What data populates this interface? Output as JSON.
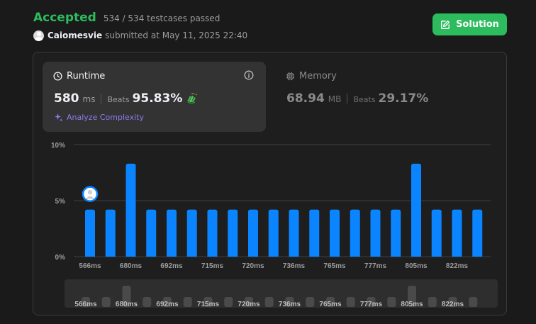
{
  "header": {
    "status": "Accepted",
    "testcases": "534 / 534 testcases passed",
    "username": "Caiomesvie",
    "submitted_at": "submitted at May 11, 2025 22:40"
  },
  "solution_button": {
    "label": "Solution",
    "icon": "edit-icon"
  },
  "runtime": {
    "title": "Runtime",
    "value": "580",
    "unit": "ms",
    "beats_label": "Beats",
    "beats_value": "95.83%",
    "analyze_label": "Analyze Complexity"
  },
  "memory": {
    "title": "Memory",
    "value": "68.94",
    "unit": "MB",
    "beats_label": "Beats",
    "beats_value": "29.17%"
  },
  "colors": {
    "accepted": "#2cbb5d",
    "bar": "#0a84ff",
    "analyze": "#8e7cf0",
    "minimap_bar": "#4a4a4a"
  },
  "chart_data": {
    "type": "bar",
    "categories": [
      "566ms",
      "",
      "680ms",
      "",
      "692ms",
      "",
      "715ms",
      "",
      "720ms",
      "",
      "736ms",
      "",
      "765ms",
      "",
      "777ms",
      "",
      "805ms",
      "",
      "822ms",
      ""
    ],
    "values": [
      4.2,
      4.2,
      8.3,
      4.2,
      4.2,
      4.2,
      4.2,
      4.2,
      4.2,
      4.2,
      4.2,
      4.2,
      4.2,
      4.2,
      4.2,
      4.2,
      8.3,
      4.2,
      4.2,
      4.2
    ],
    "ylim": [
      0,
      10
    ],
    "yticks": [
      "0%",
      "5%",
      "10%"
    ],
    "ytick_values": [
      0,
      5,
      10
    ],
    "highlight_index": 0,
    "grid": true
  }
}
